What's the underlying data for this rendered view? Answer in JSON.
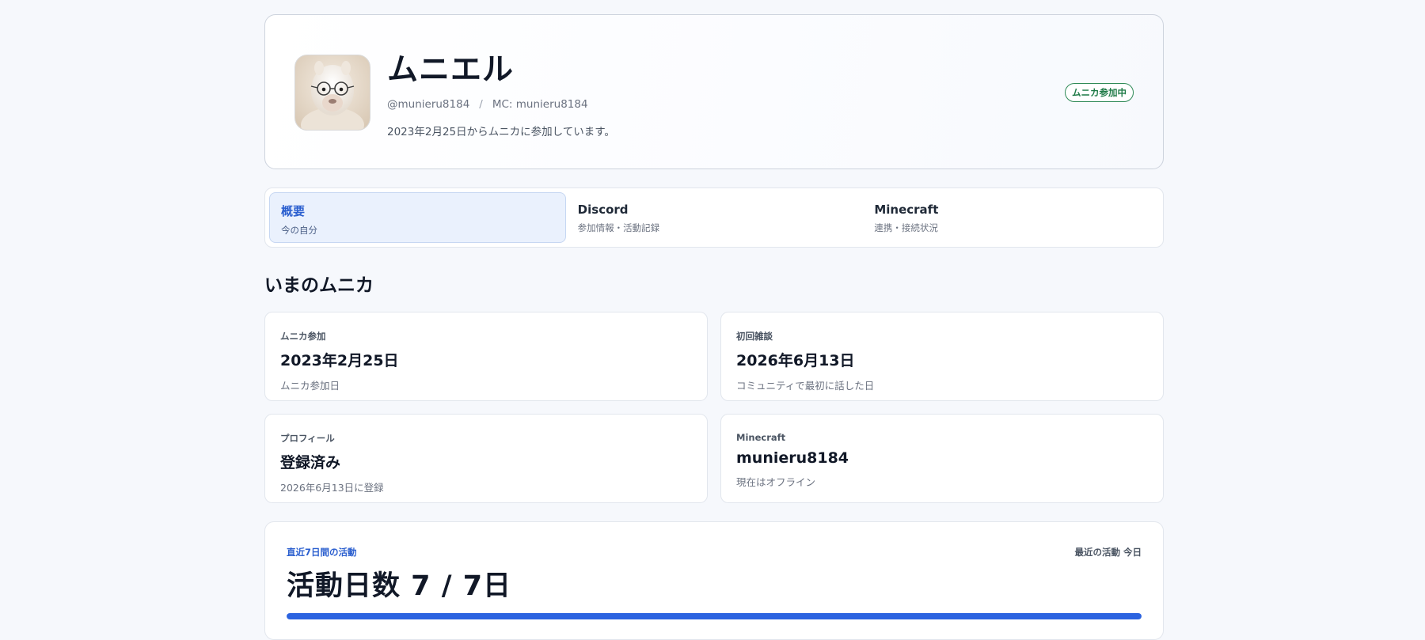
{
  "profile": {
    "name": "ムニエル",
    "handle": "@munieru8184",
    "separator": "/",
    "mc": "MC: munieru8184",
    "since": "2023年2月25日からムニカに参加しています。",
    "badge": "ムニカ参加中"
  },
  "tabs": [
    {
      "title": "概要",
      "sub": "今の自分"
    },
    {
      "title": "Discord",
      "sub": "参加情報・活動記録"
    },
    {
      "title": "Minecraft",
      "sub": "連携・接続状況"
    }
  ],
  "section_title": "いまのムニカ",
  "cards": [
    {
      "label": "ムニカ参加",
      "value": "2023年2月25日",
      "note": "ムニカ参加日"
    },
    {
      "label": "初回雑談",
      "value": "2026年6月13日",
      "note": "コミュニティで最初に話した日"
    },
    {
      "label": "プロフィール",
      "value": "登録済み",
      "note": "2026年6月13日に登録"
    },
    {
      "label": "Minecraft",
      "value": "munieru8184",
      "note": "現在はオフライン"
    }
  ],
  "activity": {
    "kicker": "直近7日間の活動",
    "recent": "最近の活動 今日",
    "title": "活動日数 7 / 7日",
    "progress": 1.0
  },
  "colors": {
    "accent": "#2b63e0",
    "badge": "#1e7a46"
  }
}
